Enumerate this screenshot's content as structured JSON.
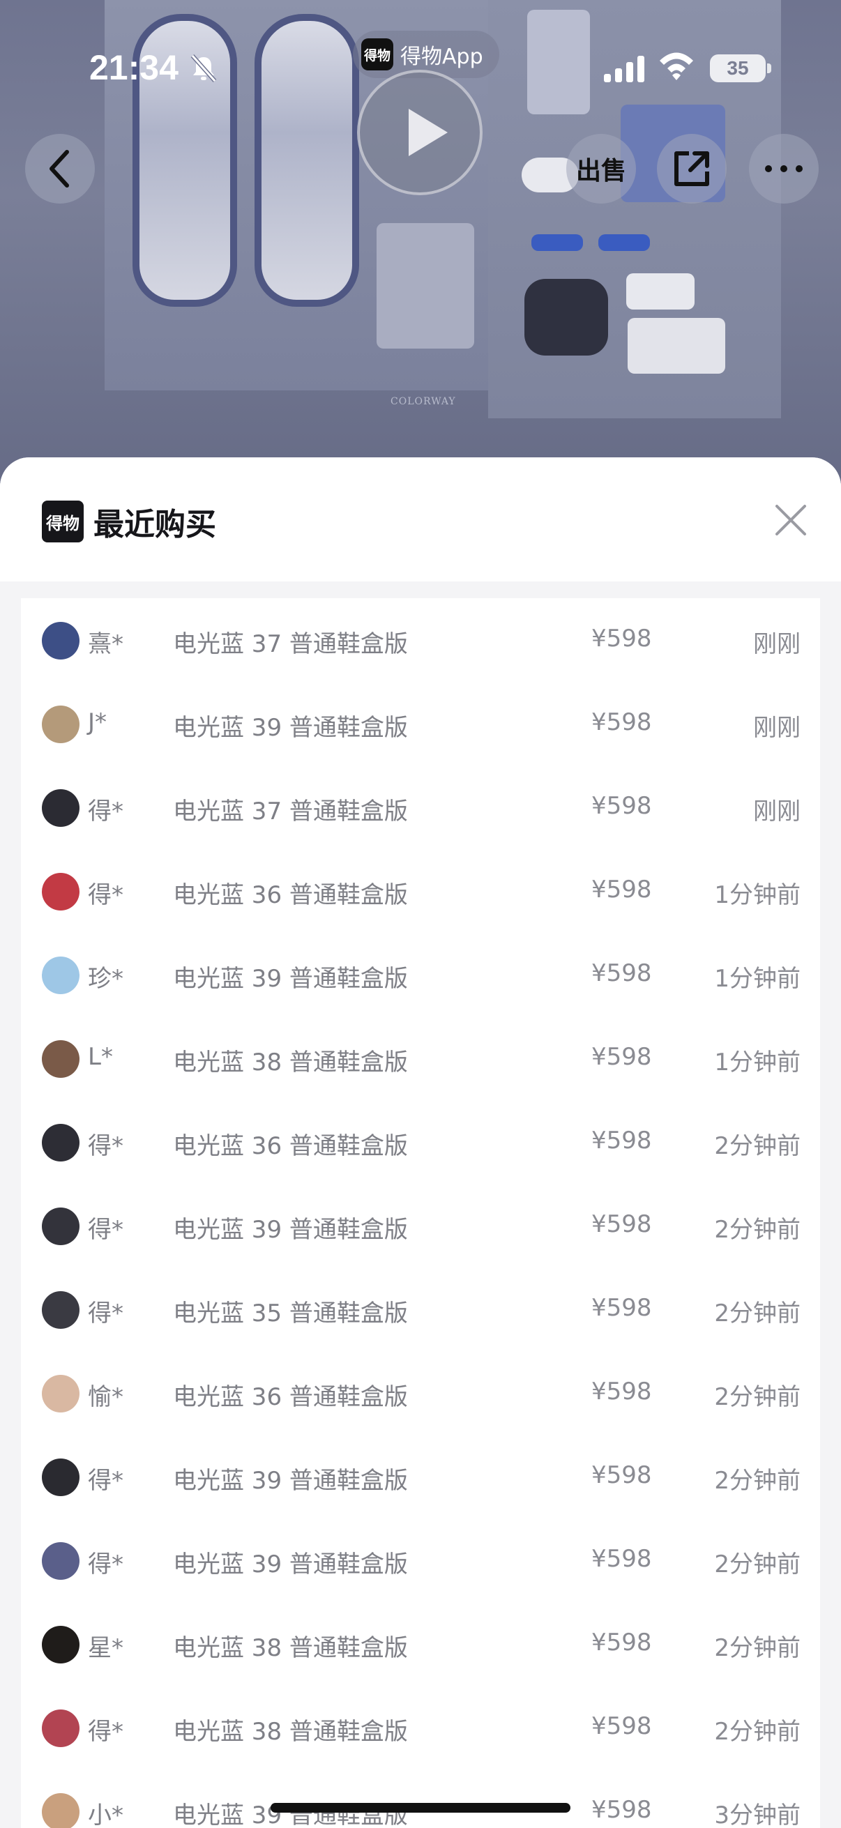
{
  "status_bar": {
    "time": "21:34",
    "battery": "35"
  },
  "header": {
    "app_pill_logo": "得物",
    "app_pill_label": "得物App",
    "sell_label": "出售"
  },
  "sheet": {
    "logo": "得物",
    "title": "最近购买"
  },
  "purchases": [
    {
      "user": "熹*",
      "desc": "电光蓝 37 普通鞋盒版",
      "price": "¥598",
      "time": "刚刚",
      "avatar_color": "#3d4f86"
    },
    {
      "user": "J*",
      "desc": "电光蓝 39 普通鞋盒版",
      "price": "¥598",
      "time": "刚刚",
      "avatar_color": "#b49a7a"
    },
    {
      "user": "得*",
      "desc": "电光蓝 37 普通鞋盒版",
      "price": "¥598",
      "time": "刚刚",
      "avatar_color": "#2b2b33"
    },
    {
      "user": "得*",
      "desc": "电光蓝 36 普通鞋盒版",
      "price": "¥598",
      "time": "1分钟前",
      "avatar_color": "#c23a44"
    },
    {
      "user": "珍*",
      "desc": "电光蓝 39 普通鞋盒版",
      "price": "¥598",
      "time": "1分钟前",
      "avatar_color": "#9ec7e6"
    },
    {
      "user": "L*",
      "desc": "电光蓝 38 普通鞋盒版",
      "price": "¥598",
      "time": "1分钟前",
      "avatar_color": "#7a5a48"
    },
    {
      "user": "得*",
      "desc": "电光蓝 36 普通鞋盒版",
      "price": "¥598",
      "time": "2分钟前",
      "avatar_color": "#2d2d35"
    },
    {
      "user": "得*",
      "desc": "电光蓝 39 普通鞋盒版",
      "price": "¥598",
      "time": "2分钟前",
      "avatar_color": "#33333b"
    },
    {
      "user": "得*",
      "desc": "电光蓝 35 普通鞋盒版",
      "price": "¥598",
      "time": "2分钟前",
      "avatar_color": "#3a3a42"
    },
    {
      "user": "愉*",
      "desc": "电光蓝 36 普通鞋盒版",
      "price": "¥598",
      "time": "2分钟前",
      "avatar_color": "#d9b8a2"
    },
    {
      "user": "得*",
      "desc": "电光蓝 39 普通鞋盒版",
      "price": "¥598",
      "time": "2分钟前",
      "avatar_color": "#2a2a30"
    },
    {
      "user": "得*",
      "desc": "电光蓝 39 普通鞋盒版",
      "price": "¥598",
      "time": "2分钟前",
      "avatar_color": "#5a5f8a"
    },
    {
      "user": "星*",
      "desc": "电光蓝 38 普通鞋盒版",
      "price": "¥598",
      "time": "2分钟前",
      "avatar_color": "#1f1c1a"
    },
    {
      "user": "得*",
      "desc": "电光蓝 38 普通鞋盒版",
      "price": "¥598",
      "time": "2分钟前",
      "avatar_color": "#b24452"
    },
    {
      "user": "小*",
      "desc": "电光蓝 39 普通鞋盒版",
      "price": "¥598",
      "time": "3分钟前",
      "avatar_color": "#c9a07e"
    }
  ]
}
